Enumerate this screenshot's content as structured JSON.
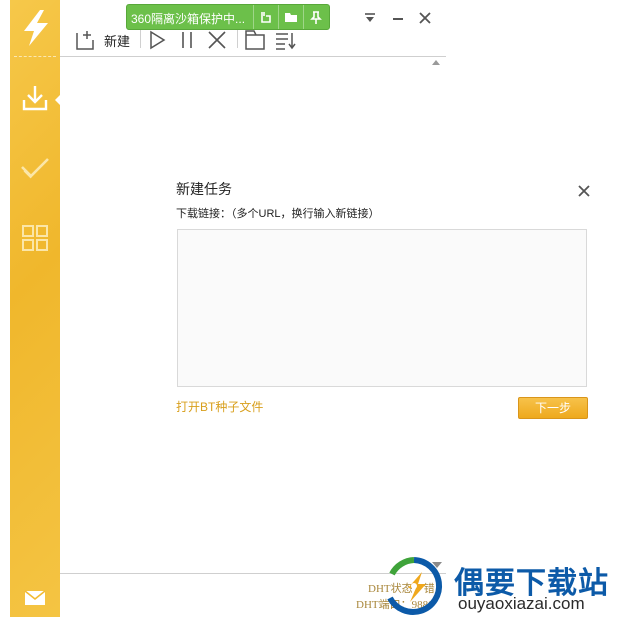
{
  "toolbar": {
    "new_label": "新建"
  },
  "sandbox": {
    "text": "360隔离沙箱保护中..."
  },
  "dialog": {
    "title": "新建任务",
    "hint": "下载链接：（多个URL，换行输入新链接）",
    "url_value": "",
    "bt_link": "打开BT种子文件",
    "next_button": "下一步"
  },
  "status": {
    "dht_state": "DHT状态：错",
    "dht_port": "DHT端口：9880"
  },
  "watermark": {
    "site_cn": "偶要下载站",
    "site_en": "ouyaoxiazai.com"
  },
  "colors": {
    "sidebar": "#f2bb32",
    "accent": "#eea91d",
    "sandbox_green": "#6cc04a",
    "watermark_blue": "#0c5aa8"
  },
  "icons": {
    "sidebar": [
      "lightning-logo-icon",
      "download-icon",
      "check-icon",
      "grid-icon",
      "mail-icon"
    ],
    "toolbar": [
      "new-task-icon",
      "play-icon",
      "pause-icon",
      "delete-icon",
      "open-folder-icon",
      "sort-list-icon"
    ]
  }
}
